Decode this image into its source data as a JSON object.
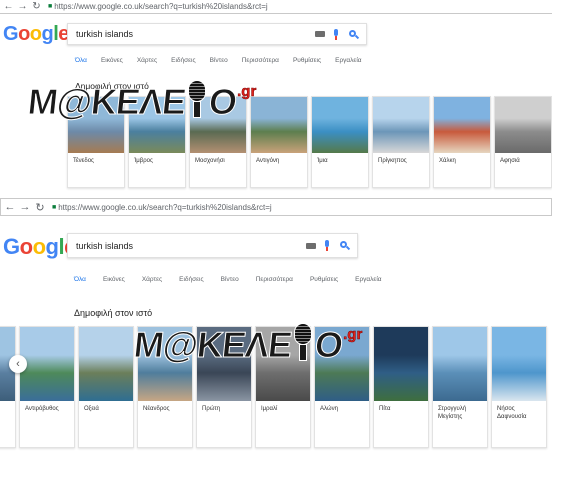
{
  "top": {
    "url": "https://www.google.co.uk/search?q=turkish%20islands&rct=j",
    "query": "turkish islands",
    "tabs": [
      {
        "label": "Όλα"
      },
      {
        "label": "Εικόνες"
      },
      {
        "label": "Χάρτες"
      },
      {
        "label": "Ειδήσεις"
      },
      {
        "label": "Βίντεο"
      },
      {
        "label": "Περισσότερα"
      },
      {
        "label": "Ρυθμίσεις"
      },
      {
        "label": "Εργαλεία"
      }
    ],
    "heading": "Δημοφιλή στον ιστό",
    "cards": [
      {
        "label": "Τένεδος",
        "colors": [
          "#8fb8d8",
          "#6d8aa8",
          "#a67b52"
        ]
      },
      {
        "label": "Ίμβρος",
        "colors": [
          "#9cc6e6",
          "#4b7f9e",
          "#7a8a5a"
        ]
      },
      {
        "label": "Μοσχονήσι",
        "colors": [
          "#a9c9e3",
          "#5a6a52",
          "#b39072"
        ]
      },
      {
        "label": "Αντιγόνη",
        "colors": [
          "#8ab4d6",
          "#5d7e4e",
          "#c9a27a"
        ]
      },
      {
        "label": "Ίμια",
        "colors": [
          "#6fb3df",
          "#3b8fc4",
          "#557a4a"
        ]
      },
      {
        "label": "Πρίγκηπος",
        "colors": [
          "#b7d4ec",
          "#6c96b8",
          "#d8d8d8"
        ]
      },
      {
        "label": "Χάλκη",
        "colors": [
          "#7fb2e0",
          "#c85a3c",
          "#e6d6c0"
        ]
      },
      {
        "label": "Αφησιά",
        "colors": [
          "#cfcfcf",
          "#8c8c8c",
          "#6a6a6a"
        ]
      }
    ]
  },
  "bottom": {
    "url": "https://www.google.co.uk/search?q=turkish%20islands&rct=j",
    "query": "turkish islands",
    "tabs": [
      {
        "label": "Όλα"
      },
      {
        "label": "Εικόνες"
      },
      {
        "label": "Χάρτες"
      },
      {
        "label": "Ειδήσεις"
      },
      {
        "label": "Βίντεο"
      },
      {
        "label": "Περισσότερα"
      },
      {
        "label": "Ρυθμίσεις"
      },
      {
        "label": "Εργαλεία"
      }
    ],
    "heading": "Δημοφιλή στον ιστό",
    "cards": [
      {
        "label": "",
        "colors": [
          "#9ec4e2",
          "#5a7fa0",
          "#3d5e7a"
        ]
      },
      {
        "label": "Αντιρόβυθος",
        "colors": [
          "#a8cbe8",
          "#4e8a5a",
          "#3a6e9a"
        ]
      },
      {
        "label": "Οξειά",
        "colors": [
          "#b5d2ea",
          "#6b7f5a",
          "#2f6e92"
        ]
      },
      {
        "label": "Νέανδρος",
        "colors": [
          "#9dc1de",
          "#4f7d9c",
          "#c6a684"
        ]
      },
      {
        "label": "Πρώτη",
        "colors": [
          "#5a6b80",
          "#3a4656",
          "#8a95a3"
        ]
      },
      {
        "label": "Ιμραλί",
        "colors": [
          "#a6a6a6",
          "#6e6e6e",
          "#4a4a4a"
        ]
      },
      {
        "label": "Αλώνη",
        "colors": [
          "#7aa8d0",
          "#4d7a55",
          "#2f5e86"
        ]
      },
      {
        "label": "Πίτα",
        "colors": [
          "#1e3a5a",
          "#2f5e86",
          "#3e6e3e"
        ]
      },
      {
        "label": "Στρογγυλή Μεγίστης",
        "colors": [
          "#9ec7e8",
          "#5b8fb8",
          "#3c6a90"
        ]
      },
      {
        "label": "Νήσος Δαφνουσία",
        "colors": [
          "#7ab6e4",
          "#4e96cc",
          "#d9e6ef"
        ]
      }
    ]
  },
  "watermark": {
    "text": "M@KEΛE",
    "text2": "O",
    "domain": ".gr"
  }
}
